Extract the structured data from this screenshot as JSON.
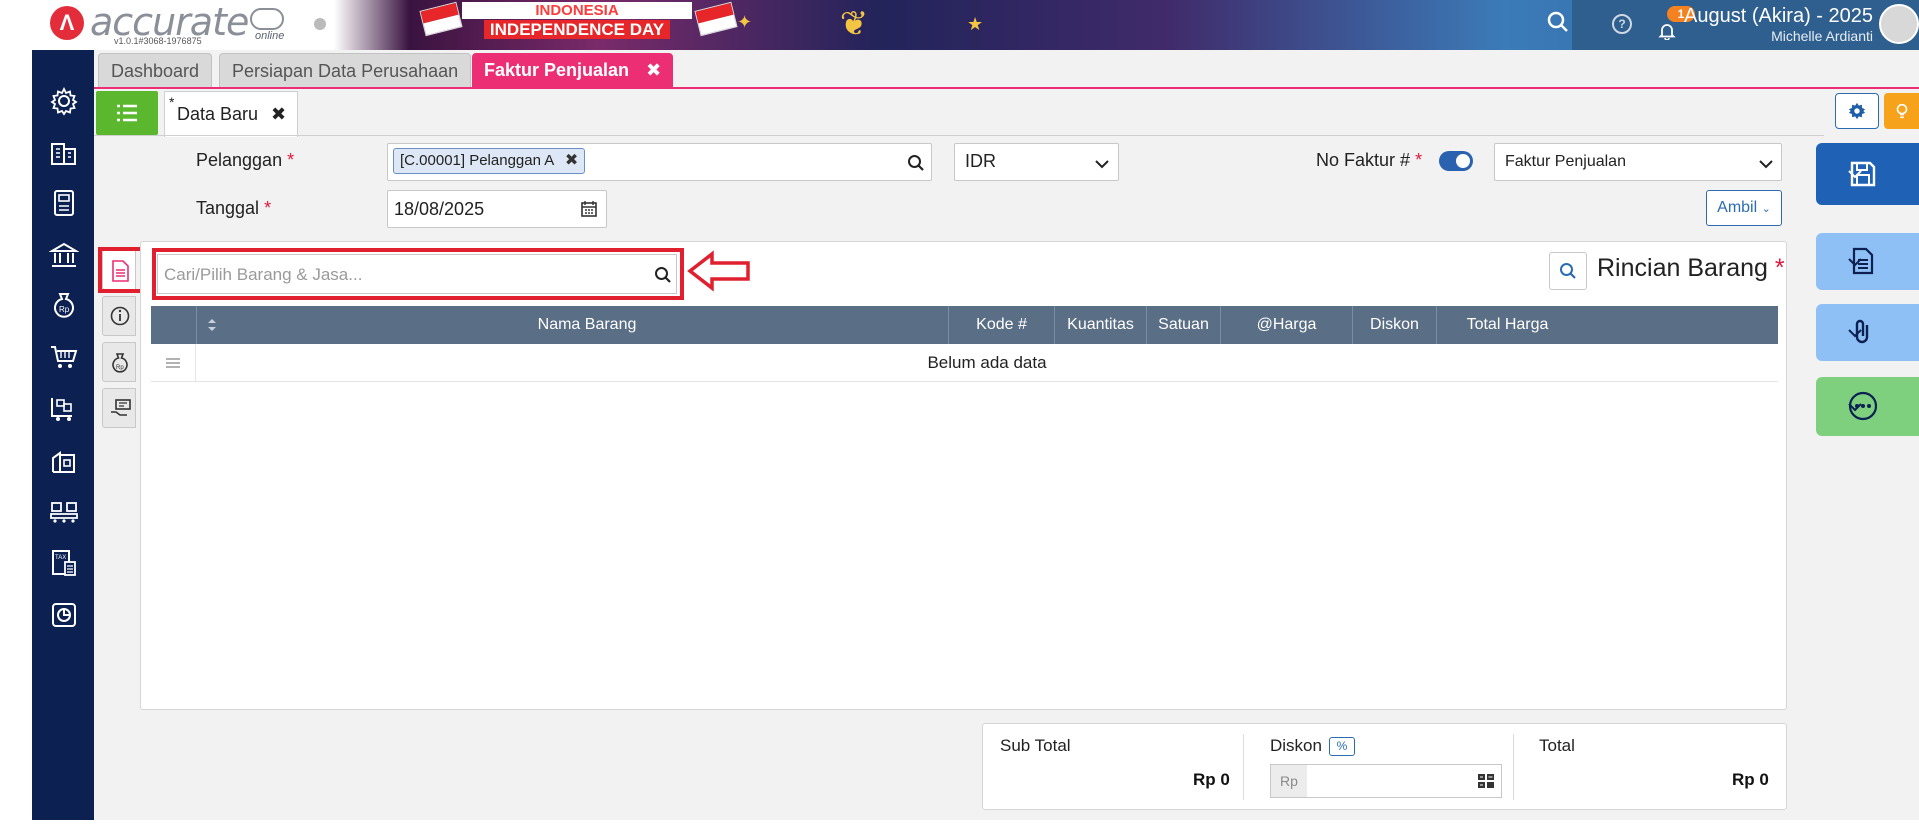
{
  "app": {
    "logo_text": "accurate",
    "logo_online": "online",
    "version": "v1.0.1#3068-1976875"
  },
  "banner": {
    "line1": "INDONESIA",
    "line2": "INDEPENDENCE DAY"
  },
  "account": {
    "notification_count": "1",
    "name": "August (Akira) - 2025",
    "user": "Michelle Ardianti"
  },
  "tabs": [
    {
      "label": "Dashboard"
    },
    {
      "label": "Persiapan Data Perusahaan"
    },
    {
      "label": "Faktur Penjualan",
      "close": "✖"
    }
  ],
  "subtab": {
    "star": "*",
    "label": "Data Baru",
    "close": "✖"
  },
  "form": {
    "pelanggan_label": "Pelanggan",
    "required_mark": "*",
    "pelanggan_value": "[C.00001] Pelanggan A",
    "chip_close": "✖",
    "currency": "IDR",
    "no_faktur_label": "No Faktur #",
    "faktur_type": "Faktur Penjualan",
    "tanggal_label": "Tanggal",
    "tanggal_value": "18/08/2025",
    "ambil_label": "Ambil"
  },
  "detail": {
    "search_placeholder": "Cari/Pilih Barang & Jasa...",
    "title": "Rincian Barang",
    "required_mark": "*",
    "columns": [
      "Nama Barang",
      "Kode #",
      "Kuantitas",
      "Satuan",
      "@Harga",
      "Diskon",
      "Total Harga"
    ],
    "empty_text": "Belum ada data"
  },
  "totals": {
    "subtotal_label": "Sub Total",
    "subtotal_value": "Rp 0",
    "diskon_label": "Diskon",
    "diskon_pct": "%",
    "diskon_prefix": "Rp",
    "total_label": "Total",
    "total_value": "Rp 0"
  },
  "colors": {
    "nav_bg": "#0c2152",
    "tab_active": "#ec2f74",
    "table_header": "#5a6e85",
    "highlight": "#e0202e",
    "save_button": "#1f62b5"
  },
  "icons": {
    "nav": [
      "settings-icon",
      "company-icon",
      "ledger-icon",
      "bank-icon",
      "money-bag-icon",
      "sales-cart-icon",
      "purchase-cart-icon",
      "warehouse-icon",
      "inventory-icon",
      "tax-icon",
      "report-icon"
    ],
    "side_tabs": [
      "document-icon",
      "info-icon",
      "money-bag-icon",
      "payment-icon"
    ]
  }
}
